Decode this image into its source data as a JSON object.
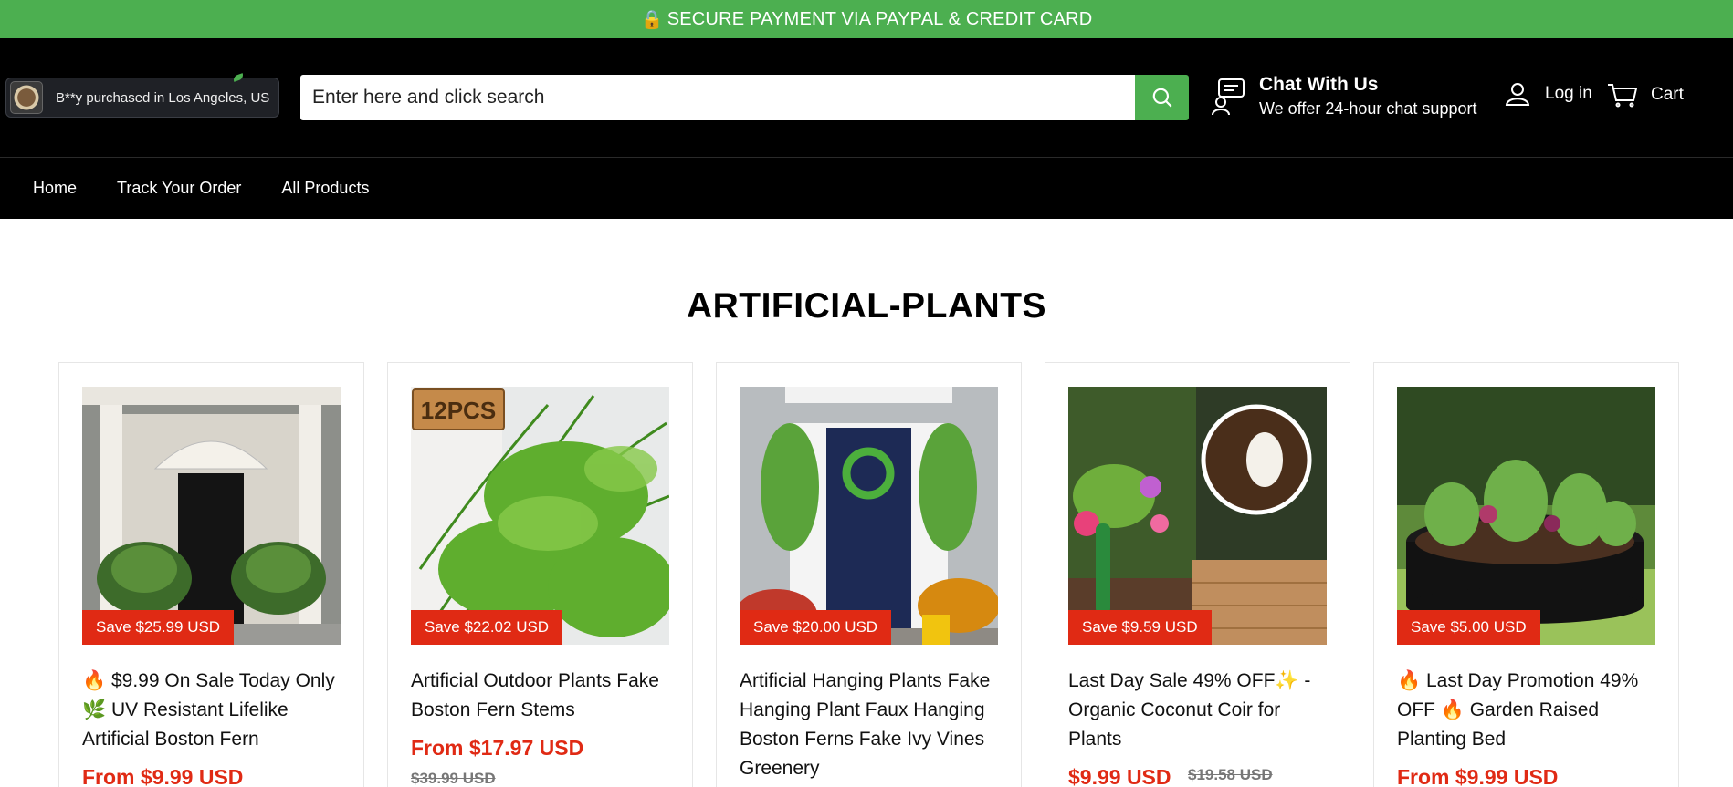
{
  "announcement": {
    "lock_icon": "🔒",
    "text": "SECURE PAYMENT VIA PAYPAL & CREDIT CARD"
  },
  "purchase_popup": {
    "text": "B**y purchased in Los Angeles, US"
  },
  "search": {
    "placeholder": "Enter here and click search",
    "button_icon": "search-icon"
  },
  "chat": {
    "title": "Chat With Us",
    "subtitle": "We offer 24-hour chat support"
  },
  "account": {
    "login_label": "Log in",
    "cart_label": "Cart"
  },
  "nav": {
    "items": [
      "Home",
      "Track Your Order",
      "All Products"
    ]
  },
  "collection": {
    "title": "ARTIFICIAL-PLANTS"
  },
  "products": [
    {
      "badge": "Save $25.99 USD",
      "title": "🔥 $9.99 On Sale Today Only 🌿 UV Resistant Lifelike Artificial Boston Fern",
      "price": "From $9.99 USD",
      "compare_price": ""
    },
    {
      "badge": "Save $22.02 USD",
      "title": "Artificial Outdoor Plants Fake Boston Fern Stems",
      "price": "From $17.97 USD",
      "compare_price": "$39.99 USD",
      "image_label": "12PCS"
    },
    {
      "badge": "Save $20.00 USD",
      "title": "Artificial Hanging Plants Fake Hanging Plant Faux Hanging Boston Ferns Fake Ivy Vines Greenery",
      "price": "",
      "compare_price": ""
    },
    {
      "badge": "Save $9.59 USD",
      "title": "Last Day Sale 49% OFF✨ - Organic Coconut Coir for Plants",
      "price": "$9.99 USD",
      "compare_price": "$19.58 USD"
    },
    {
      "badge": "Save $5.00 USD",
      "title": "🔥 Last Day Promotion 49% OFF 🔥 Garden Raised Planting Bed",
      "price": "From $9.99 USD",
      "compare_price": ""
    }
  ],
  "colors": {
    "accent_green": "#4caf50",
    "sale_red": "#e02a14",
    "header_bg": "#000000"
  }
}
